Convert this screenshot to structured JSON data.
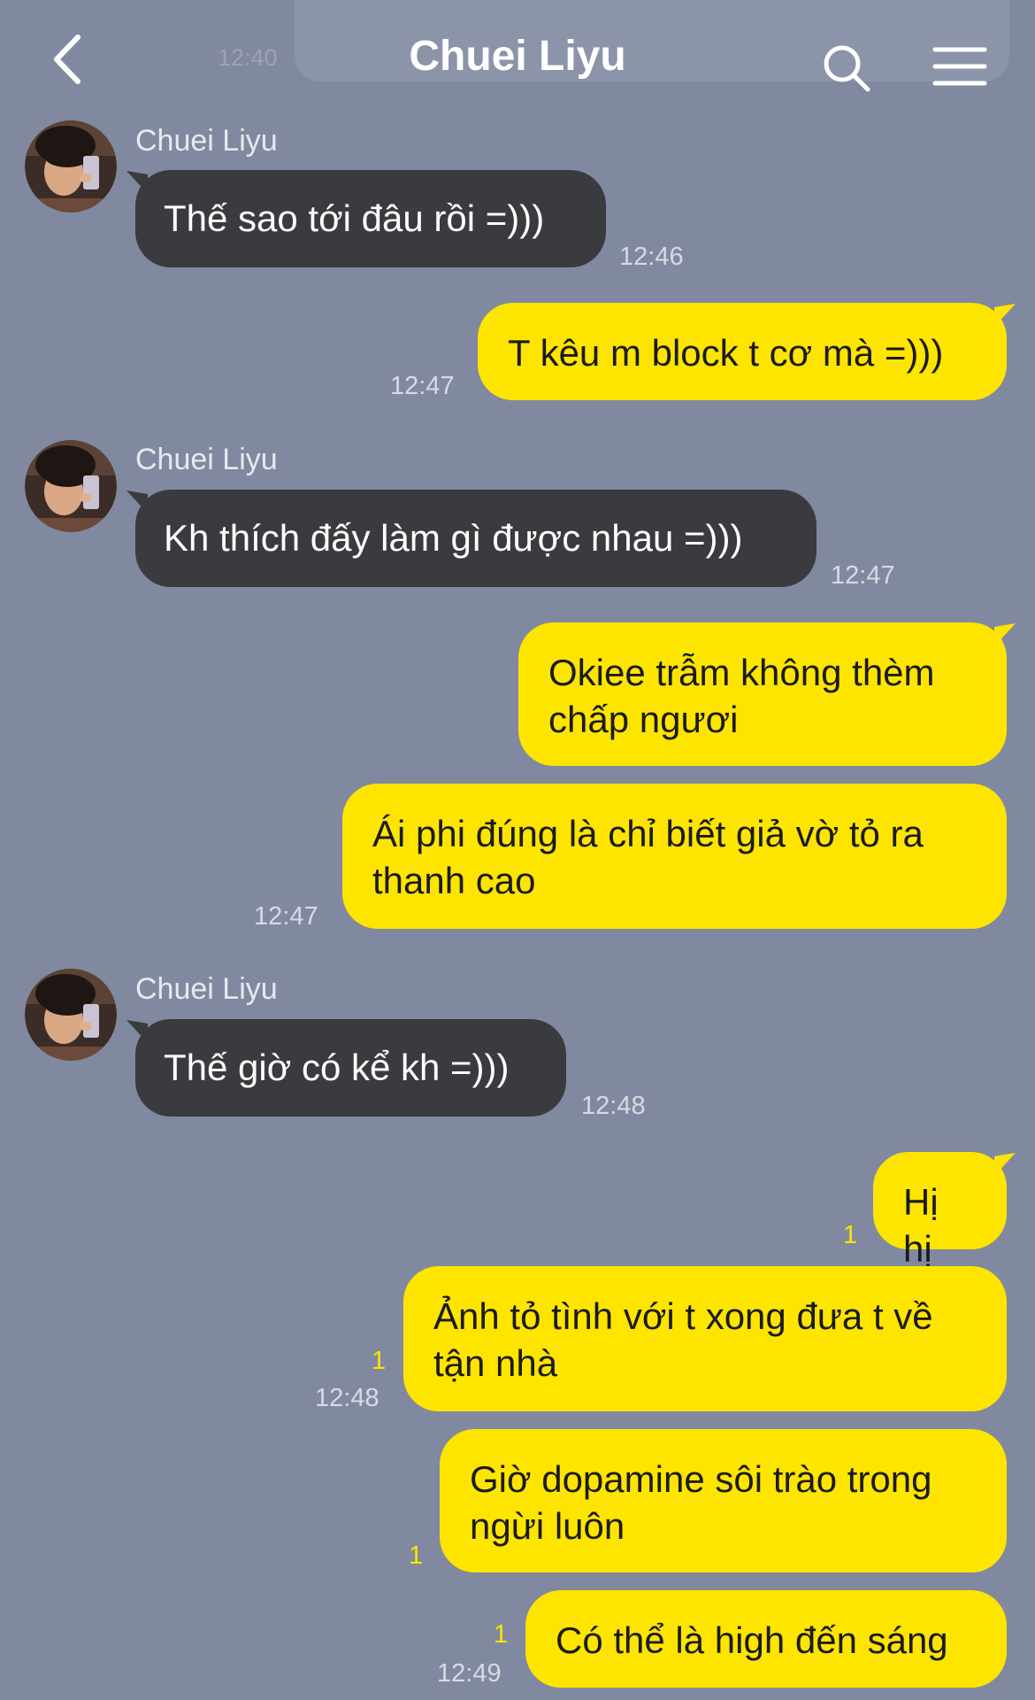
{
  "header": {
    "contact_name": "Chuei Liyu",
    "ghost_time": "12:40"
  },
  "messages": [
    {
      "side": "in",
      "sender": "Chuei Liyu",
      "text": "Thế sao tới đâu rồi =)))",
      "time": "12:46"
    },
    {
      "side": "out",
      "text": "T kêu m block t cơ mà =)))",
      "time": "12:47"
    },
    {
      "side": "in",
      "sender": "Chuei Liyu",
      "text": "Kh thích đấy làm gì được nhau =)))",
      "time": "12:47"
    },
    {
      "side": "out",
      "text": "Okiee trẫm không thèm\nchấp ngươi"
    },
    {
      "side": "out",
      "text": "Ái phi đúng là chỉ biết giả vờ tỏ ra\nthanh cao",
      "time": "12:47"
    },
    {
      "side": "in",
      "sender": "Chuei Liyu",
      "text": "Thế giờ có kể kh =)))",
      "time": "12:48"
    },
    {
      "side": "out",
      "text": "Hị hị",
      "unread": "1"
    },
    {
      "side": "out",
      "text": "Ảnh tỏ tình với t xong đưa t về\ntận nhà",
      "unread": "1",
      "time": "12:48"
    },
    {
      "side": "out",
      "text": "Giờ dopamine sôi trào trong\nngừi luôn",
      "unread": "1"
    },
    {
      "side": "out",
      "text": "Có thể là high đến sáng",
      "unread": "1",
      "time": "12:49"
    }
  ],
  "colors": {
    "background": "#8189a0",
    "incoming_bubble": "#3a3b3e",
    "outgoing_bubble": "#fde500",
    "unread_count": "#fde500"
  },
  "icons": [
    "back-arrow-icon",
    "search-icon",
    "menu-icon"
  ]
}
